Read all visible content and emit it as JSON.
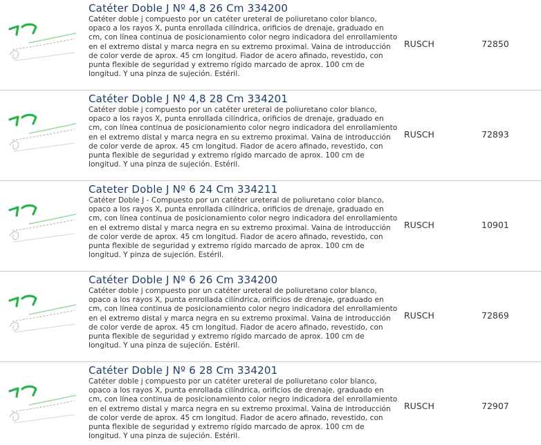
{
  "products": [
    {
      "title": "Catéter Doble J Nº 4,8 26 Cm 334200",
      "description": "Catéter doble j compuesto por un catéter ureteral de poliuretano color blanco, opaco a los rayos X, punta enrollada cilíndrica, orificios de drenaje, graduado en cm, con línea continua de posicionamiento color negro indicadora del enrollamiento en el extremo distal y marca negra en su extremo proximal. Vaina de introducción de color verde de aprox. 45 cm longitud. Fiador de acero afinado, revestido, con punta flexible de seguridad y extremo rígido marcado de aprox. 100 cm de longitud. Y una pinza de sujeción. Estéril.",
      "brand": "RUSCH",
      "code": "72850"
    },
    {
      "title": "Catéter Doble J Nº 4,8 28 Cm 334201",
      "description": "Catéter doble j compuesto por un catéter ureteral de poliuretano color blanco, opaco a los rayos X, punta enrollada cilíndrica, orificios de drenaje, graduado en cm, con línea continua de posicionamiento color negro indicadora del enrollamiento en el extremo distal y marca negra en su extremo proximal. Vaina de introducción de color verde de aprox. 45 cm longitud. Fiador de acero afinado, revestido, con punta flexible de seguridad y extremo rígido marcado de aprox. 100 cm de longitud. Y una pinza de sujeción. Estéril.",
      "brand": "RUSCH",
      "code": "72893"
    },
    {
      "title": "Cateter Doble J Nº 6 24 Cm 334211",
      "description": "Catéter Doble J - Compuesto por un catéter ureteral de poliuretano color blanco, opaco a los rayos X, punta enrollada cilíndrica, orificios de drenaje, graduado en cm, con línea continua de posicionamiento color negro indicadora del enrollamiento en el extremo distal y marca negra en su extremo proximal. Vaina de introducción de color verde de aprox. 45 cm longitud. Fiador de acero afinado, revestido, con punta flexible de seguridad y extremo rígido marcado de aprox. 100 cm de longitud. Y pinza de sujeción. Estéril.",
      "brand": "RUSCH",
      "code": "10901"
    },
    {
      "title": "Catéter Doble J Nº 6 26 Cm 334200",
      "description": "Catéter doble j compuesto por un catéter ureteral de poliuretano color blanco, opaco a los rayos X, punta enrollada cilíndrica, orificios de drenaje, graduado en cm, con línea continua de posicionamiento color negro indicadora del enrollamiento en el extremo distal y marca negra en su extremo proximal. Vaina de introducción de color verde de aprox. 45 cm longitud. Fiador de acero afinado, revestido, con punta flexible de seguridad y extremo rígido marcado de aprox. 100 cm de longitud. Y una pinza de sujeción. Estéril.",
      "brand": "RUSCH",
      "code": "72869"
    },
    {
      "title": "Catéter Doble J Nº 6 28 Cm 334201",
      "description": "Catéter doble j compuesto por un catéter ureteral de poliuretano color blanco, opaco a los rayos X, punta enrollada cilíndrica, orificios de drenaje, graduado en cm, con línea continua de posicionamiento color negro indicadora del enrollamiento en el extremo distal y marca negra en su extremo proximal. Vaina de introducción de color verde de aprox. 45 cm longitud. Fiador de acero afinado, revestido, con punta flexible de seguridad y extremo rígido marcado de aprox. 100 cm de longitud. Y una pinza de sujeción. Estéril.",
      "brand": "RUSCH",
      "code": "72907"
    }
  ],
  "colors": {
    "title": "#1f3d6b",
    "text": "#333333",
    "divider": "#c8c8c8",
    "catheter_green": "#2ab34a"
  },
  "icons": {
    "product_thumbnail": "catheter-product-image"
  }
}
